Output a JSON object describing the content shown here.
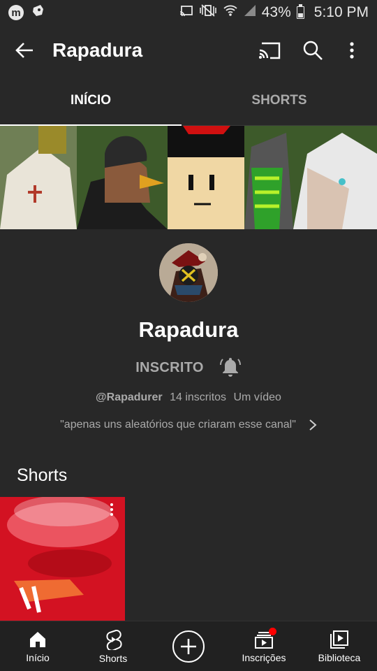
{
  "status_bar": {
    "icons_left": [
      "m-app-icon",
      "game-controller-icon"
    ],
    "icons_right": [
      "cast-icon",
      "vibrate-off-icon",
      "wifi-icon",
      "signal-icon",
      "battery-icon"
    ],
    "battery": "43%",
    "time": "5:10 PM",
    "m_badge": "m"
  },
  "app_bar": {
    "title": "Rapadura",
    "actions": [
      "cast-icon",
      "search-icon",
      "more-vert-icon"
    ]
  },
  "tabs": [
    {
      "label": "INÍCIO",
      "active": true
    },
    {
      "label": "SHORTS",
      "active": false
    }
  ],
  "channel": {
    "name": "Rapadura",
    "subscribe_label": "INSCRITO",
    "handle": "@Rapadurer",
    "subscribers": "14 inscritos",
    "videos": "Um vídeo",
    "description": "\"apenas uns aleatórios que criaram esse canal\""
  },
  "shorts_section": {
    "title": "Shorts"
  },
  "bottom_nav": [
    {
      "label": "Início",
      "icon": "home-icon",
      "active": true
    },
    {
      "label": "Shorts",
      "icon": "shorts-icon",
      "active": false
    },
    {
      "label": "",
      "icon": "create-plus-icon",
      "active": false
    },
    {
      "label": "Inscrições",
      "icon": "subscriptions-icon",
      "active": false
    },
    {
      "label": "Biblioteca",
      "icon": "library-icon",
      "active": false
    }
  ],
  "colors": {
    "background": "#282828",
    "bottom_nav": "#212121",
    "notification_dot": "#ff0000"
  }
}
